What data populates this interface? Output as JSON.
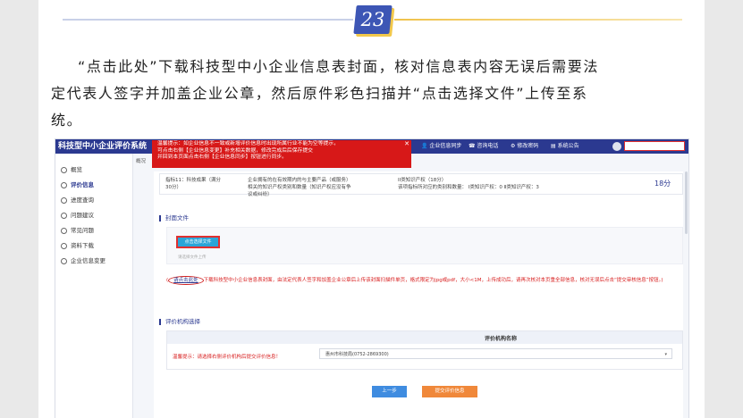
{
  "step_number": "23",
  "paragraph": {
    "line1": "“点击此处”下载科技型中小企业信息表封面，核对信息表内容无误后需要法",
    "line2": "定代表人签字并加盖企业公章，然后原件彩色扫描并“点击选择文件”上传至系",
    "line3": "统。"
  },
  "app": {
    "title": "科技型中小企业评价系统",
    "nav": [
      "企业信息同步",
      "咨询电话",
      "修改密码",
      "系统公告"
    ]
  },
  "alert": {
    "line1": "温馨提示：如企业信息不一致或新增评价信息时出现所属行业不能为空等提示，",
    "line2": "可点击右侧【企业信息变更】补充相关数据，修改完成后后保存提交",
    "line3": "并回到本页面点击右侧【企业信息同步】按钮进行同步。",
    "close": "✕"
  },
  "sidebar": {
    "items": [
      "概览",
      "评价信息",
      "进度查询",
      "问题建议",
      "常见问题",
      "资料下载",
      "企业信息变更"
    ],
    "active_index": 1
  },
  "tab_label": "概况",
  "indicator_row": {
    "name": "指标11：科技成果（满分30分）",
    "description": "企业拥有的在有效期内的与主要产品（或服务）相关的知识产权类别和数量（知识产权应没有争议或纠纷）",
    "detail_line1": "II类知识产权（18分）",
    "detail_line2": "该项指标所对应的类别和数量： Ⅰ类知识产权：0 Ⅱ类知识产权：3",
    "score": "18分"
  },
  "cover_section": {
    "heading": "封面文件",
    "choose_button": "点击选择文件",
    "small_hint": "请选择文件上传",
    "note_prefix": "(",
    "note_link": "请点击此处",
    "note_text": "下载科技型中小企业信息表封面，由法定代表人签字和加盖企业公章后上传该封面扫描件单页，格式限定为jpg或pdf，大小<1M，上传成功后，请再次核对本页重全部信息，核对无误后点击“提交审核信息”按钮。)"
  },
  "institution_section": {
    "heading": "评价机构选择",
    "column_header": "评价机构名称",
    "warning": "温馨提示：请选择右侧评价机构后提交评价信息！",
    "selected": "惠州市科技局(0752-2869300)",
    "dropdown_arrow": "▾"
  },
  "buttons": {
    "prev": "上一步",
    "submit": "提交评价信息"
  },
  "colors": {
    "header_blue": "#2b3990",
    "badge_blue": "#3d56b5",
    "alert_red": "#d71818",
    "accent_orange": "#f0883a",
    "choose_cyan": "#2aa5d8"
  }
}
